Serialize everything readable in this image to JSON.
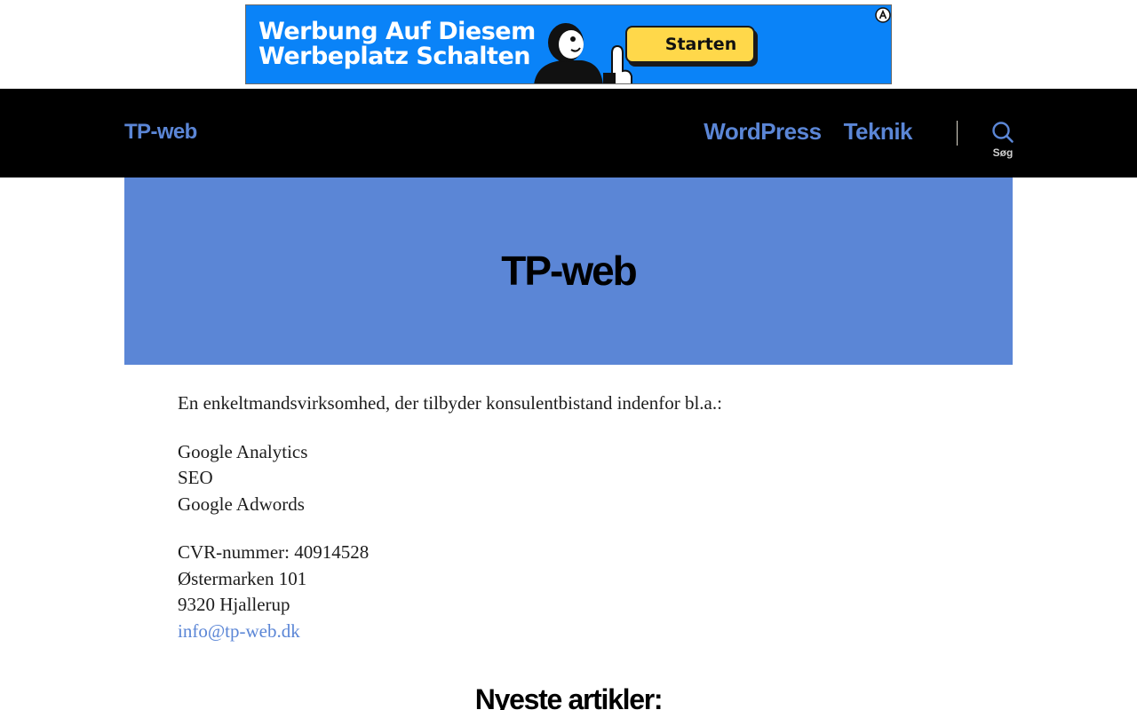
{
  "ad": {
    "headline_line1": "Werbung Auf Diesem",
    "headline_line2": "Werbeplatz Schalten",
    "cta_label": "Starten",
    "badge_icon": "adsense-badge-icon",
    "background_color": "#0a83f8",
    "cta_color": "#ffd84a"
  },
  "header": {
    "site_title": "TP-web",
    "nav_items": [
      {
        "label": "WordPress"
      },
      {
        "label": "Teknik"
      }
    ],
    "search_label": "Søg",
    "search_icon": "search-icon",
    "accent_color": "#5b86d6"
  },
  "hero": {
    "title": "TP-web",
    "background_color": "#5b86d6"
  },
  "content": {
    "intro": "En enkeltmandsvirksomhed, der tilbyder konsulentbistand indenfor bl.a.:",
    "services": [
      "Google Analytics",
      "SEO",
      "Google Adwords"
    ],
    "company": {
      "cvr": "CVR-nummer: 40914528",
      "street": "Østermarken 101",
      "city": "9320 Hjallerup",
      "email": "info@tp-web.dk"
    },
    "latest_heading": "Nyeste artikler:"
  }
}
